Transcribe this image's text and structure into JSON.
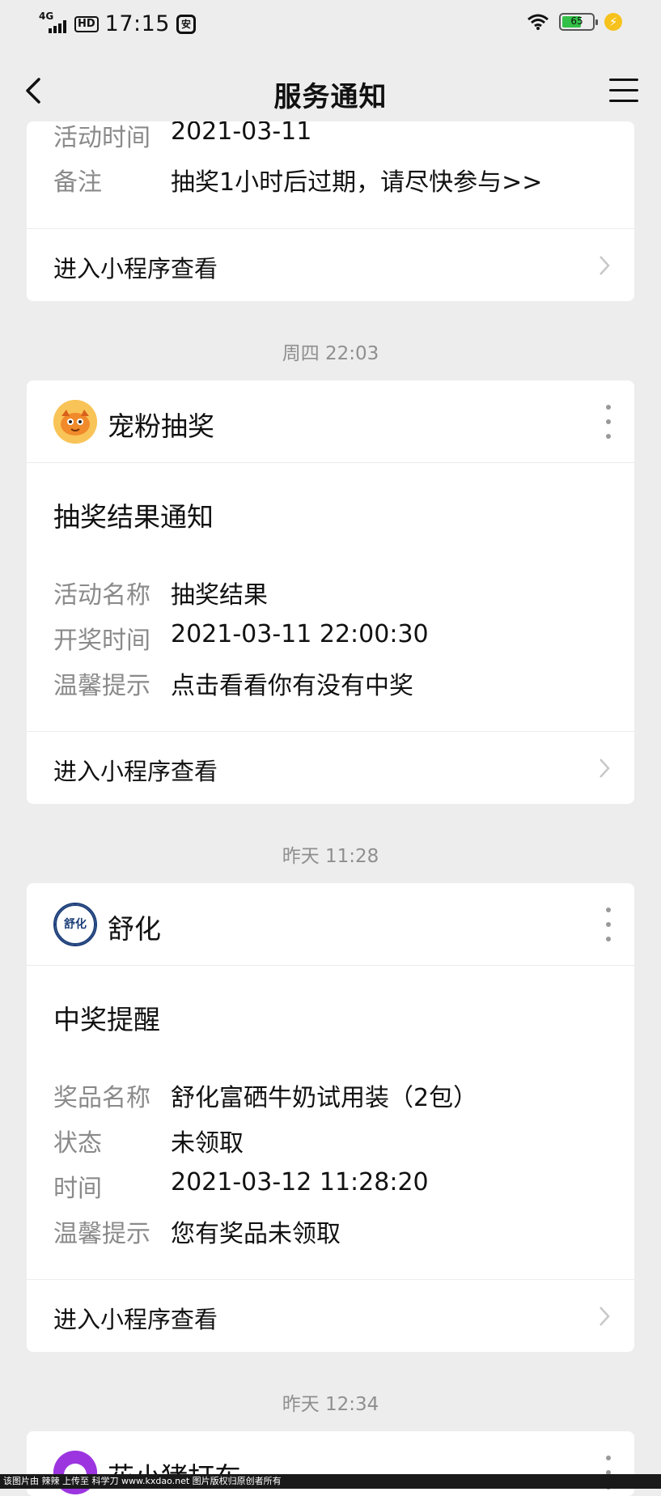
{
  "status_bar": {
    "network": "4G",
    "hd": "HD",
    "time": "17:15",
    "app_badge": "安",
    "battery": "65",
    "battery_level": 0.65,
    "icons": [
      "signal-icon",
      "wifi-icon",
      "battery-icon",
      "charging-icon"
    ]
  },
  "nav": {
    "title": "服务通知",
    "back_icon": "back-chevron-icon",
    "menu_icon": "menu-icon"
  },
  "cards": [
    {
      "rows": [
        {
          "key": "活动时间",
          "value": "2021-03-11"
        },
        {
          "key": "备注",
          "value": "抽奖1小时后过期，请尽快参与>>"
        }
      ],
      "footer": "进入小程序查看"
    },
    {
      "timestamp": "周四 22:03",
      "name": "宠粉抽奖",
      "title": "抽奖结果通知",
      "rows": [
        {
          "key": "活动名称",
          "value": "抽奖结果"
        },
        {
          "key": "开奖时间",
          "value": "2021-03-11 22:00:30"
        },
        {
          "key": "温馨提示",
          "value": "点击看看你有没有中奖"
        }
      ],
      "footer": "进入小程序查看"
    },
    {
      "timestamp": "昨天 11:28",
      "name": "舒化",
      "logo_text": "舒化",
      "title": "中奖提醒",
      "rows": [
        {
          "key": "奖品名称",
          "value": "舒化富硒牛奶试用装（2包）"
        },
        {
          "key": "状态",
          "value": "未领取"
        },
        {
          "key": "时间",
          "value": "2021-03-12 11:28:20"
        },
        {
          "key": "温馨提示",
          "value": "您有奖品未领取"
        }
      ],
      "footer": "进入小程序查看"
    },
    {
      "timestamp": "昨天 12:34",
      "name": "花小猪打车"
    }
  ],
  "watermark": "该图片由 辣辣 上传至 科学刀 www.kxdao.net 图片版权归原创者所有",
  "colors": {
    "background": "#ededed",
    "card": "#ffffff",
    "label_gray": "#8a8a8a",
    "battery_green": "#33c048",
    "charge_yellow": "#f6c21b"
  }
}
